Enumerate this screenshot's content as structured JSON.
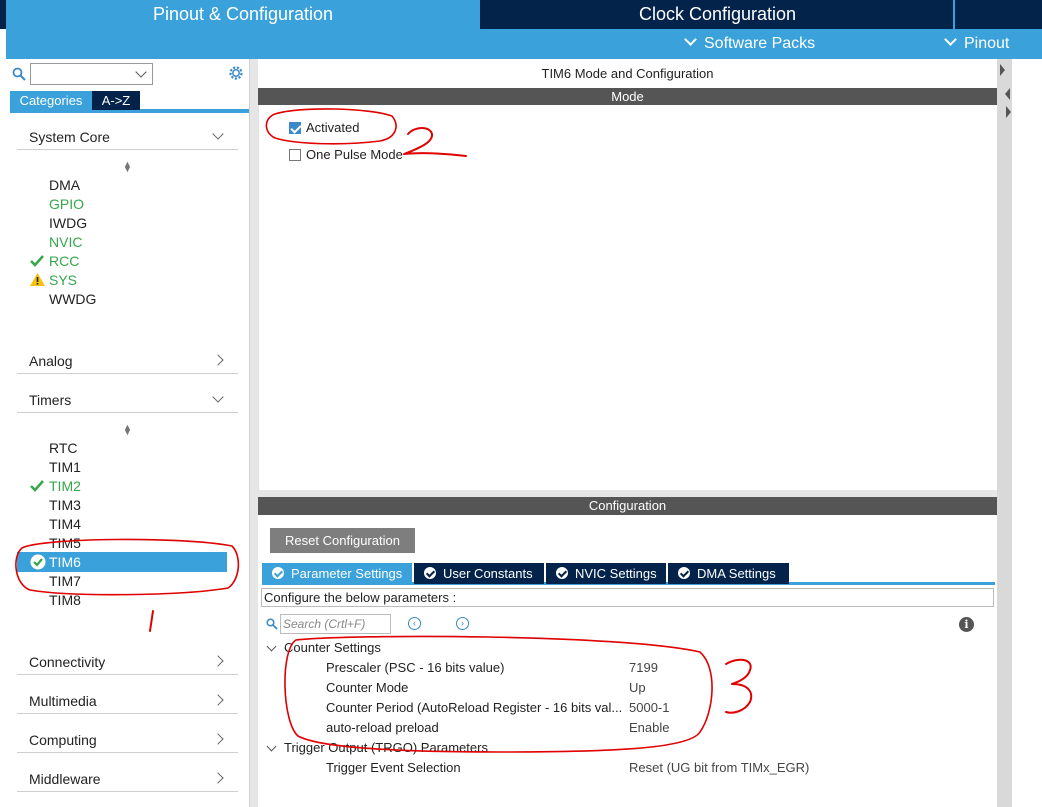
{
  "top_tabs": {
    "pinout": "Pinout & Configuration",
    "clock": "Clock Configuration"
  },
  "sub_menu": {
    "software_packs": "Software Packs",
    "pinout": "Pinout"
  },
  "sidebar": {
    "search_value": "",
    "tabs": [
      "Categories",
      "A->Z"
    ],
    "groups": {
      "system_core": {
        "label": "System Core",
        "items": [
          {
            "label": "DMA",
            "status": "none"
          },
          {
            "label": "GPIO",
            "status": "configured"
          },
          {
            "label": "IWDG",
            "status": "none"
          },
          {
            "label": "NVIC",
            "status": "configured"
          },
          {
            "label": "RCC",
            "status": "ok"
          },
          {
            "label": "SYS",
            "status": "warning"
          },
          {
            "label": "WWDG",
            "status": "none"
          }
        ]
      },
      "analog": {
        "label": "Analog"
      },
      "timers": {
        "label": "Timers",
        "items": [
          {
            "label": "RTC",
            "status": "none"
          },
          {
            "label": "TIM1",
            "status": "none"
          },
          {
            "label": "TIM2",
            "status": "ok"
          },
          {
            "label": "TIM3",
            "status": "none"
          },
          {
            "label": "TIM4",
            "status": "none"
          },
          {
            "label": "TIM5",
            "status": "none"
          },
          {
            "label": "TIM6",
            "status": "selected"
          },
          {
            "label": "TIM7",
            "status": "none"
          },
          {
            "label": "TIM8",
            "status": "none"
          }
        ]
      },
      "connectivity": {
        "label": "Connectivity"
      },
      "multimedia": {
        "label": "Multimedia"
      },
      "computing": {
        "label": "Computing"
      },
      "middleware": {
        "label": "Middleware"
      }
    }
  },
  "main": {
    "title": "TIM6 Mode and Configuration",
    "mode_header": "Mode",
    "mode_options": [
      {
        "label": "Activated",
        "checked": true
      },
      {
        "label": "One Pulse Mode",
        "checked": false
      }
    ],
    "config_header": "Configuration",
    "reset_button": "Reset Configuration",
    "tabs": [
      "Parameter Settings",
      "User Constants",
      "NVIC Settings",
      "DMA Settings"
    ],
    "description": "Configure the below parameters :",
    "search_placeholder": "Search (Crtl+F)",
    "counter_settings": {
      "label": "Counter Settings",
      "params": [
        {
          "name": "Prescaler (PSC - 16 bits value)",
          "value": "7199"
        },
        {
          "name": "Counter Mode",
          "value": "Up"
        },
        {
          "name": "Counter Period (AutoReload Register - 16 bits val...",
          "value": "5000-1"
        },
        {
          "name": "auto-reload preload",
          "value": "Enable"
        }
      ]
    },
    "trigger_output": {
      "label": "Trigger Output (TRGO) Parameters",
      "params": [
        {
          "name": "Trigger Event Selection",
          "value": "Reset (UG bit from TIMx_EGR)"
        }
      ]
    }
  },
  "annotations": [
    "1",
    "2",
    "3"
  ],
  "colors": {
    "navy": "#03234b",
    "accent_blue": "#3aa1da",
    "ok_green": "#37a54b",
    "warning_yellow": "#f4c20d",
    "annotation_red": "#e00000"
  }
}
